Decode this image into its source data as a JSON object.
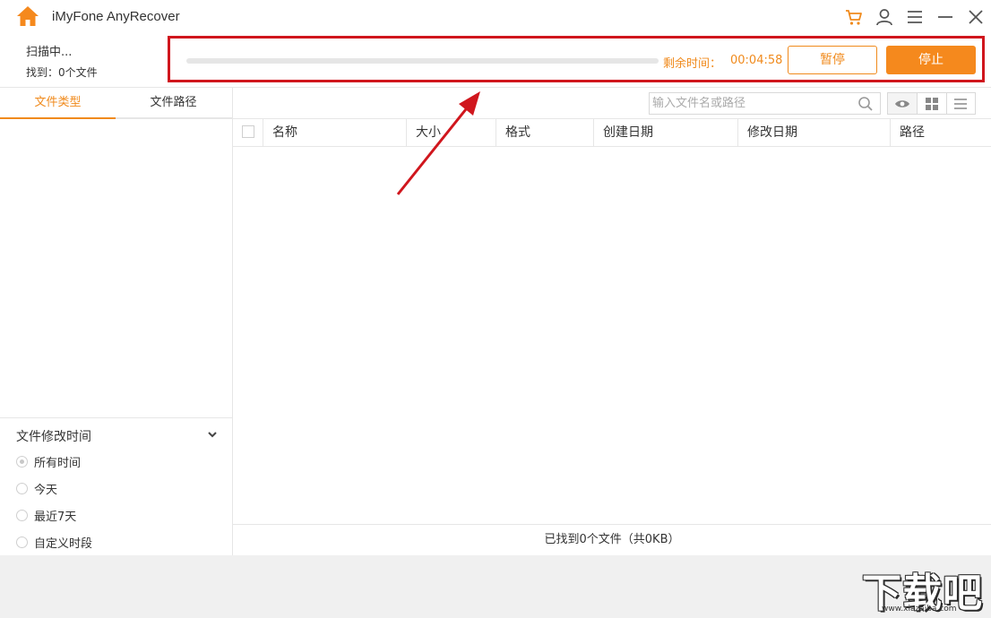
{
  "app": {
    "title": "iMyFone AnyRecover"
  },
  "scan": {
    "status": "扫描中...",
    "found": "找到：0个文件",
    "progress": 0.0,
    "remaining_label": "剩余时间：",
    "remaining_value": "00:04:58",
    "pause_label": "暂停",
    "stop_label": "停止"
  },
  "sidebar": {
    "tabs": [
      {
        "label": "文件类型",
        "active": true
      },
      {
        "label": "文件路径",
        "active": false
      }
    ],
    "filter": {
      "title": "文件修改时间",
      "options": [
        {
          "label": "所有时间",
          "checked": true
        },
        {
          "label": "今天",
          "checked": false
        },
        {
          "label": "最近7天",
          "checked": false
        },
        {
          "label": "自定义时段",
          "checked": false
        }
      ]
    }
  },
  "main": {
    "search_placeholder": "输入文件名或路径",
    "columns": [
      "名称",
      "大小",
      "格式",
      "创建日期",
      "修改日期",
      "路径"
    ],
    "footer": "已找到0个文件（共0KB）"
  },
  "watermark": {
    "main": "下载吧",
    "sub": "www.xiazaiba.com"
  },
  "colors": {
    "accent": "#f08a1c",
    "highlight": "#d0161d"
  }
}
